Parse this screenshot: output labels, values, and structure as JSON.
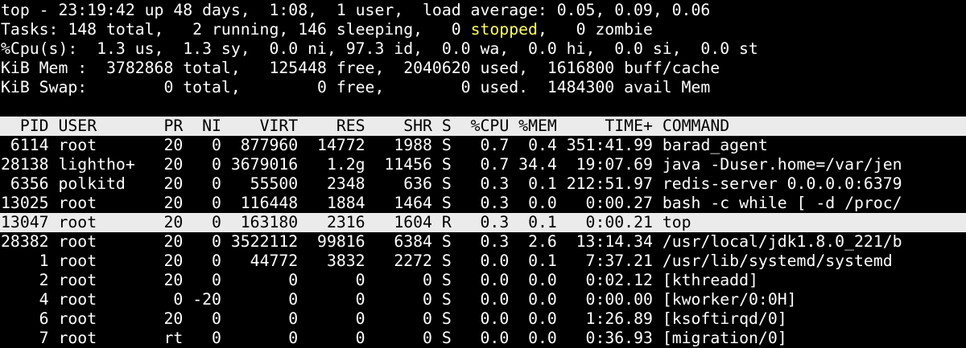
{
  "colors": {
    "background": "#000000",
    "foreground": "#ffffff",
    "highlight_bg": "#ebebeb",
    "highlight_fg": "#000000",
    "stopped": "#ffff54"
  },
  "summary": {
    "uptime_line": "top - 23:19:42 up 48 days,  1:08,  1 user,  load average: 0.05, 0.09, 0.06",
    "tasks_prefix": "Tasks: 148 total,   2 running, 146 sleeping,   0 ",
    "tasks_stopped": "stopped",
    "tasks_suffix": ",   0 zombie",
    "cpu_line": "%Cpu(s):  1.3 us,  1.3 sy,  0.0 ni, 97.3 id,  0.0 wa,  0.0 hi,  0.0 si,  0.0 st",
    "mem_line": "KiB Mem :  3782868 total,   125448 free,  2040620 used,  1616800 buff/cache",
    "swap_line": "KiB Swap:        0 total,        0 free,        0 used.  1484300 avail Mem"
  },
  "table": {
    "header": {
      "pid": "PID",
      "user": "USER",
      "pr": "PR",
      "ni": "NI",
      "virt": "VIRT",
      "res": "RES",
      "shr": "SHR",
      "s": "S",
      "cpu": "%CPU",
      "mem": "%MEM",
      "time": "TIME+",
      "command": "COMMAND"
    },
    "rows": [
      {
        "pid": "6114",
        "user": "root",
        "pr": "20",
        "ni": "0",
        "virt": "877960",
        "res": "14772",
        "shr": "1988",
        "s": "S",
        "cpu": "0.7",
        "mem": "0.4",
        "time": "351:41.99",
        "command": "barad_agent"
      },
      {
        "pid": "28138",
        "user": "lightho+",
        "pr": "20",
        "ni": "0",
        "virt": "3679016",
        "res": "1.2g",
        "shr": "11456",
        "s": "S",
        "cpu": "0.7",
        "mem": "34.4",
        "time": "19:07.69",
        "command": "java -Duser.home=/var/jen"
      },
      {
        "pid": "6356",
        "user": "polkitd",
        "pr": "20",
        "ni": "0",
        "virt": "55500",
        "res": "2348",
        "shr": "636",
        "s": "S",
        "cpu": "0.3",
        "mem": "0.1",
        "time": "212:51.97",
        "command": "redis-server 0.0.0.0:6379"
      },
      {
        "pid": "13025",
        "user": "root",
        "pr": "20",
        "ni": "0",
        "virt": "116448",
        "res": "1884",
        "shr": "1464",
        "s": "S",
        "cpu": "0.3",
        "mem": "0.0",
        "time": "0:00.27",
        "command": "bash -c while [ -d /proc/"
      },
      {
        "pid": "13047",
        "user": "root",
        "pr": "20",
        "ni": "0",
        "virt": "163180",
        "res": "2316",
        "shr": "1604",
        "s": "R",
        "cpu": "0.3",
        "mem": "0.1",
        "time": "0:00.21",
        "command": "top"
      },
      {
        "pid": "28382",
        "user": "root",
        "pr": "20",
        "ni": "0",
        "virt": "3522112",
        "res": "99816",
        "shr": "6384",
        "s": "S",
        "cpu": "0.3",
        "mem": "2.6",
        "time": "13:14.34",
        "command": "/usr/local/jdk1.8.0_221/b"
      },
      {
        "pid": "1",
        "user": "root",
        "pr": "20",
        "ni": "0",
        "virt": "44772",
        "res": "3832",
        "shr": "2272",
        "s": "S",
        "cpu": "0.0",
        "mem": "0.1",
        "time": "7:37.21",
        "command": "/usr/lib/systemd/systemd"
      },
      {
        "pid": "2",
        "user": "root",
        "pr": "20",
        "ni": "0",
        "virt": "0",
        "res": "0",
        "shr": "0",
        "s": "S",
        "cpu": "0.0",
        "mem": "0.0",
        "time": "0:02.12",
        "command": "[kthreadd]"
      },
      {
        "pid": "4",
        "user": "root",
        "pr": "0",
        "ni": "-20",
        "virt": "0",
        "res": "0",
        "shr": "0",
        "s": "S",
        "cpu": "0.0",
        "mem": "0.0",
        "time": "0:00.00",
        "command": "[kworker/0:0H]"
      },
      {
        "pid": "6",
        "user": "root",
        "pr": "20",
        "ni": "0",
        "virt": "0",
        "res": "0",
        "shr": "0",
        "s": "S",
        "cpu": "0.0",
        "mem": "0.0",
        "time": "1:26.89",
        "command": "[ksoftirqd/0]"
      },
      {
        "pid": "7",
        "user": "root",
        "pr": "rt",
        "ni": "0",
        "virt": "0",
        "res": "0",
        "shr": "0",
        "s": "S",
        "cpu": "0.0",
        "mem": "0.0",
        "time": "0:36.93",
        "command": "[migration/0]"
      }
    ]
  }
}
